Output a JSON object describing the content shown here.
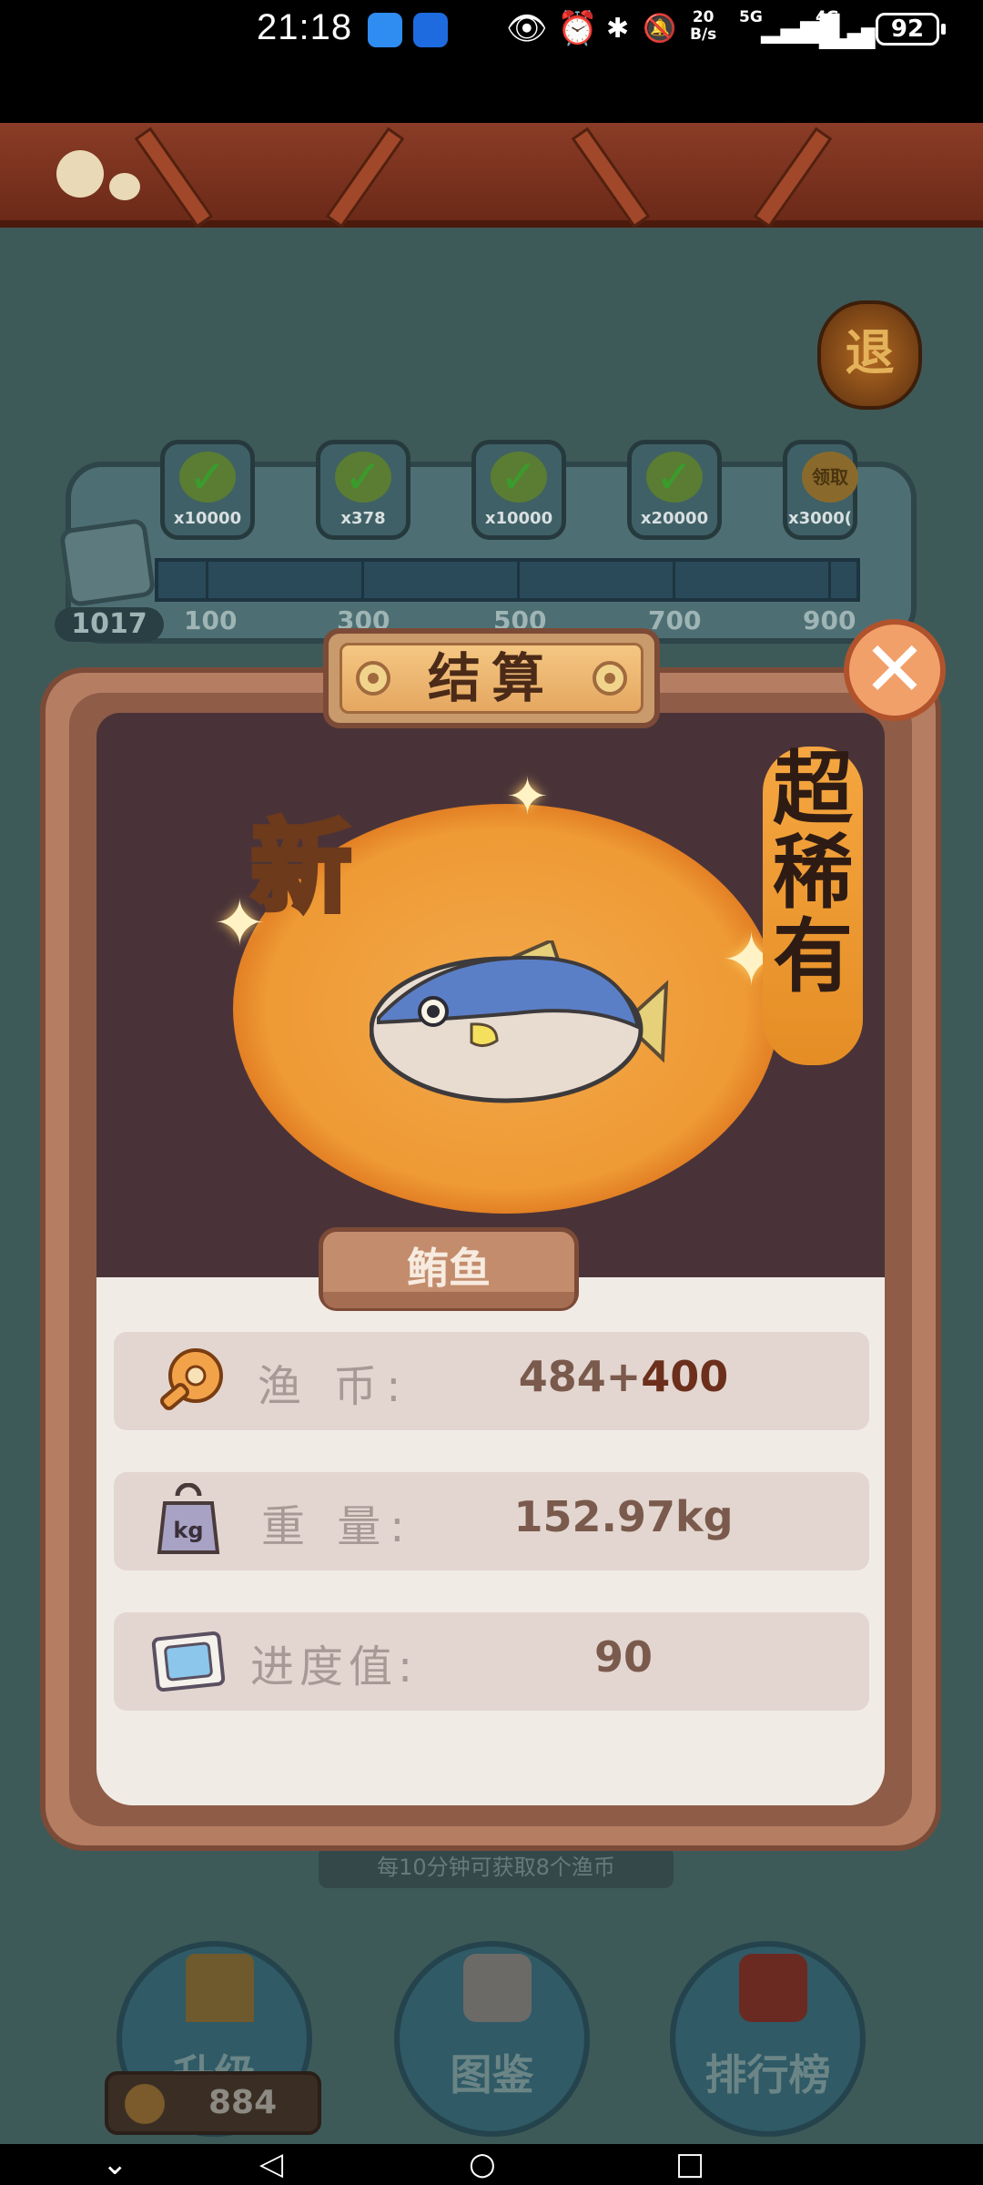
{
  "status_bar": {
    "time": "21:18",
    "net_speed_top": "20",
    "net_speed_bottom": "B/s",
    "network_5g": "5G",
    "network_4g": "4G",
    "battery": "92"
  },
  "background": {
    "exit_label": "退",
    "progress_count": "1017",
    "rewards": [
      {
        "label": "x10000",
        "claimed": true
      },
      {
        "label": "x378",
        "claimed": true
      },
      {
        "label": "x10000",
        "claimed": true
      },
      {
        "label": "x20000",
        "claimed": true
      },
      {
        "label": "x3000(",
        "claimed": false,
        "badge": "领取"
      }
    ],
    "milestones": [
      "100",
      "300",
      "500",
      "700",
      "900"
    ],
    "hint": "每10分钟可获取8个渔币",
    "buttons": {
      "upgrade": "升级",
      "catalog": "图鉴",
      "leaderboard": "排行榜"
    },
    "coins": "884"
  },
  "dialog": {
    "title": "结算",
    "new_badge": "新",
    "rarity": [
      "超",
      "稀",
      "有"
    ],
    "fish_name": "鲔鱼",
    "stats": {
      "coins_label": "渔  币:",
      "coins_value": "484+",
      "coins_bonus": "400",
      "weight_label": "重  量:",
      "weight_value": "152.97kg",
      "progress_label": "进度值:",
      "progress_value": "90"
    },
    "icons": {
      "weight_icon_text": "kg"
    }
  }
}
